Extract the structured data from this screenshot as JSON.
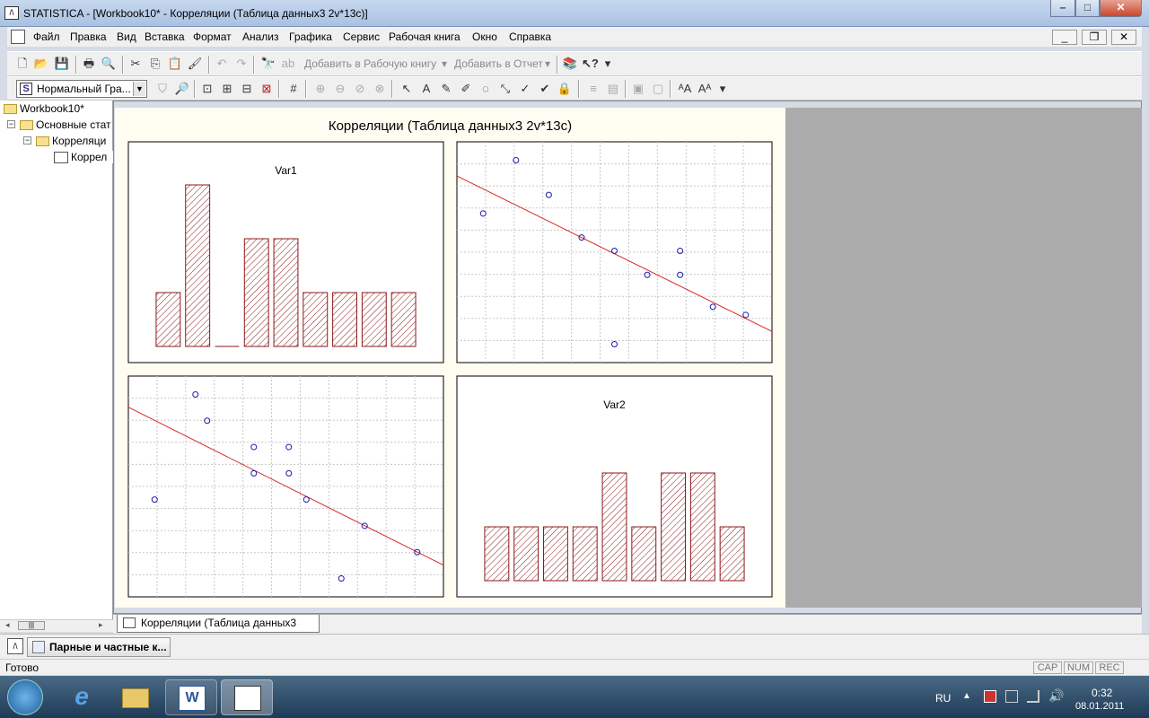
{
  "window": {
    "title": "STATISTICA - [Workbook10* - Корреляции (Таблица данных3 2v*13c)]",
    "app_icon": "statistica-icon",
    "min": "–",
    "max": "□",
    "close": "✕"
  },
  "menu": {
    "items": [
      "Файл",
      "Правка",
      "Вид",
      "Вставка",
      "Формат",
      "Анализ",
      "Графика",
      "Сервис",
      "Рабочая книга",
      "Окно",
      "Справка"
    ]
  },
  "toolbar1": {
    "add_workbook": "Добавить в Рабочую книгу",
    "add_report": "Добавить в Отчет"
  },
  "toolbar2": {
    "style_select": "Нормальный Гра..."
  },
  "tree": {
    "root": "Workbook10*",
    "n1": "Основные стат",
    "n2": "Корреляци",
    "n3": "Коррел"
  },
  "graph": {
    "title": "Корреляции (Таблица данных3 2v*13c)",
    "var1": "Var1",
    "var2": "Var2"
  },
  "tabs": {
    "doc": "Корреляции (Таблица данных3 2v*13c)"
  },
  "taskpane": {
    "button": "Парные и частные к..."
  },
  "status": {
    "text": "Готово",
    "cap": "CAP",
    "num": "NUM",
    "rec": "REC"
  },
  "tray": {
    "lang": "RU",
    "time": "0:32",
    "date": "08.01.2011"
  },
  "colors": {
    "bar_stroke": "#8b1a1a",
    "line": "#d62828",
    "point": "#1a1aa8",
    "plot_bg": "#fffcf1"
  },
  "chart_data": [
    {
      "type": "bar",
      "name": "Var1 histogram",
      "title": "Var1",
      "values": [
        1,
        3,
        0,
        2,
        2,
        1,
        1,
        1,
        1
      ]
    },
    {
      "type": "scatter",
      "name": "Var2 vs Var1",
      "points": [
        [
          1.0,
          4.5
        ],
        [
          2.0,
          6.5
        ],
        [
          3.0,
          5.2
        ],
        [
          4.0,
          3.6
        ],
        [
          5.0,
          3.1
        ],
        [
          5.0,
          -0.4
        ],
        [
          6.0,
          2.2
        ],
        [
          7.0,
          3.1
        ],
        [
          7.0,
          2.2
        ],
        [
          8.0,
          1.0
        ],
        [
          9.0,
          0.7
        ]
      ],
      "fit_line": true
    },
    {
      "type": "scatter",
      "name": "Var1 vs Var2",
      "points": [
        [
          0.5,
          4.0
        ],
        [
          1.2,
          8.0
        ],
        [
          1.4,
          7.0
        ],
        [
          2.2,
          5.0
        ],
        [
          2.2,
          6.0
        ],
        [
          2.8,
          6.0
        ],
        [
          2.8,
          5.0
        ],
        [
          3.1,
          4.0
        ],
        [
          3.7,
          1.0
        ],
        [
          4.1,
          3.0
        ],
        [
          5.0,
          2.0
        ]
      ],
      "fit_line": true
    },
    {
      "type": "bar",
      "name": "Var2 histogram",
      "title": "Var2",
      "values": [
        1,
        1,
        1,
        1,
        2,
        1,
        2,
        2,
        1
      ]
    }
  ]
}
